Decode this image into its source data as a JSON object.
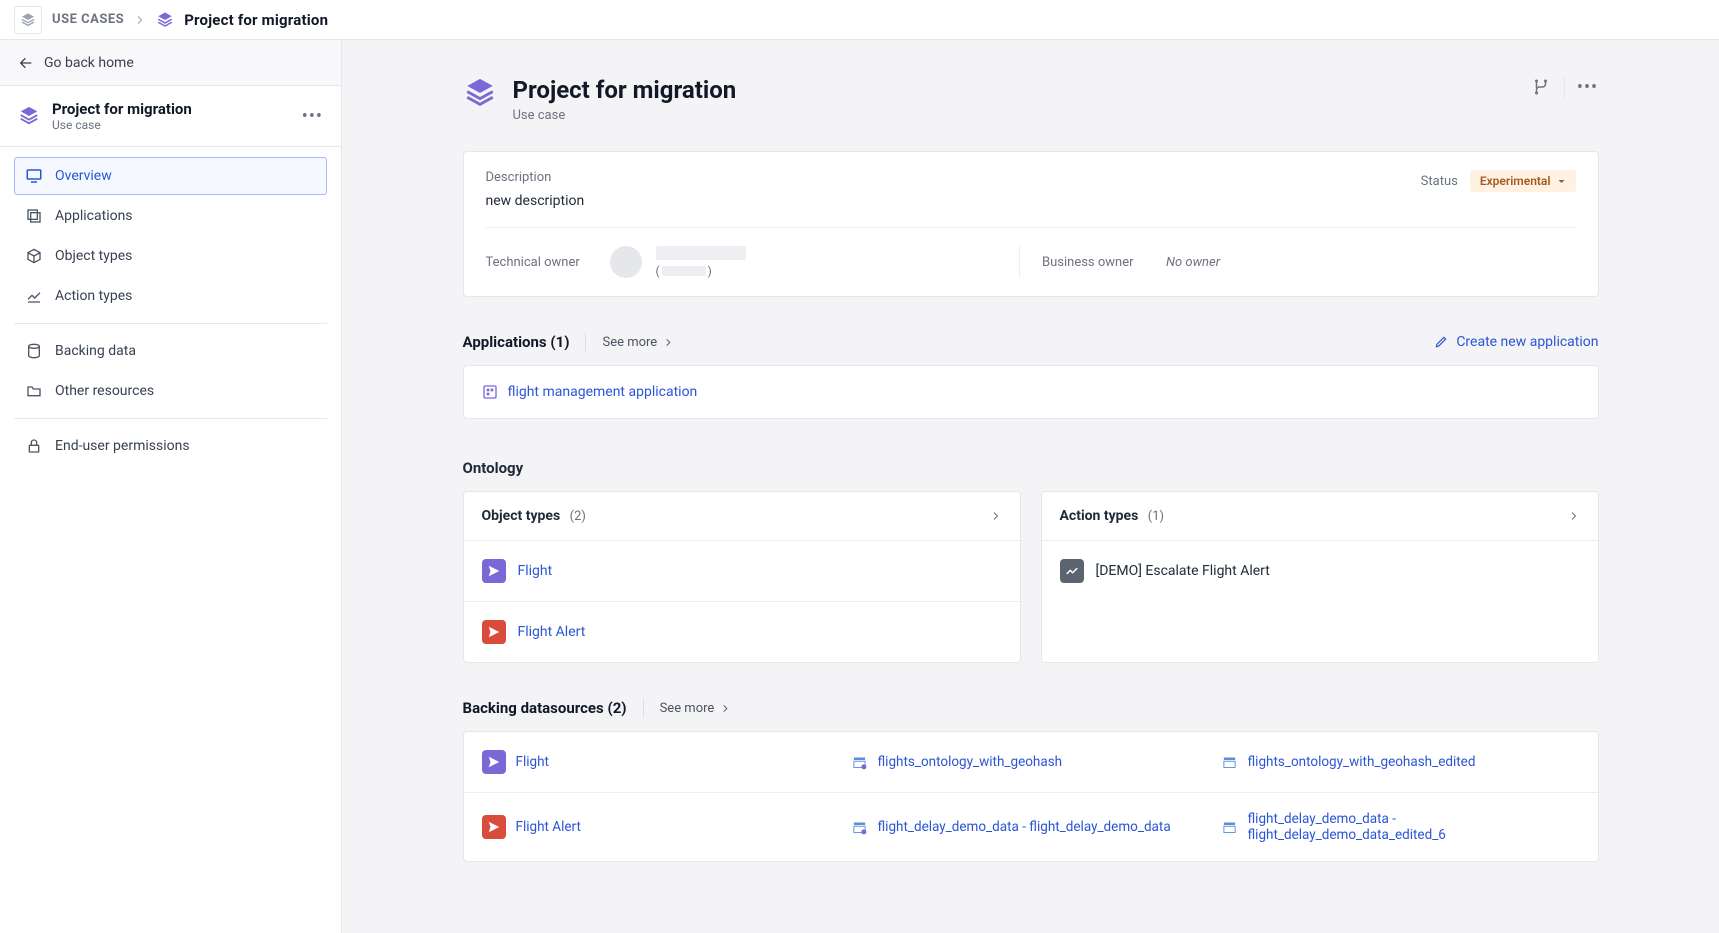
{
  "breadcrumb": {
    "root": "USE CASES",
    "current": "Project for migration"
  },
  "sidebar": {
    "goback": "Go back home",
    "project_title": "Project for migration",
    "project_subtitle": "Use case",
    "nav": {
      "overview": "Overview",
      "applications": "Applications",
      "object_types": "Object types",
      "action_types": "Action types",
      "backing_data": "Backing data",
      "other_resources": "Other resources",
      "end_user_permissions": "End-user permissions"
    }
  },
  "header": {
    "title": "Project for migration",
    "subtitle": "Use case"
  },
  "description": {
    "label": "Description",
    "value": "new description",
    "status_label": "Status",
    "status_value": "Experimental"
  },
  "owners": {
    "technical_label": "Technical owner",
    "business_label": "Business owner",
    "no_owner": "No owner"
  },
  "applications": {
    "title": "Applications (1)",
    "see_more": "See more",
    "create": "Create new application",
    "items": {
      "0": {
        "name": "flight management application"
      }
    }
  },
  "ontology": {
    "label": "Ontology",
    "object_types": {
      "title": "Object types",
      "count": "(2)",
      "items": {
        "0": {
          "name": "Flight"
        },
        "1": {
          "name": "Flight Alert"
        }
      }
    },
    "action_types": {
      "title": "Action types",
      "count": "(1)",
      "items": {
        "0": {
          "name": "[DEMO] Escalate Flight Alert"
        }
      }
    }
  },
  "datasources": {
    "title": "Backing datasources (2)",
    "see_more": "See more",
    "rows": {
      "0": {
        "obj": "Flight",
        "c1": "flights_ontology_with_geohash",
        "c2": "flights_ontology_with_geohash_edited"
      },
      "1": {
        "obj": "Flight Alert",
        "c1": "flight_delay_demo_data - flight_delay_demo_data",
        "c2": "flight_delay_demo_data - flight_delay_demo_data_edited_6"
      }
    }
  }
}
